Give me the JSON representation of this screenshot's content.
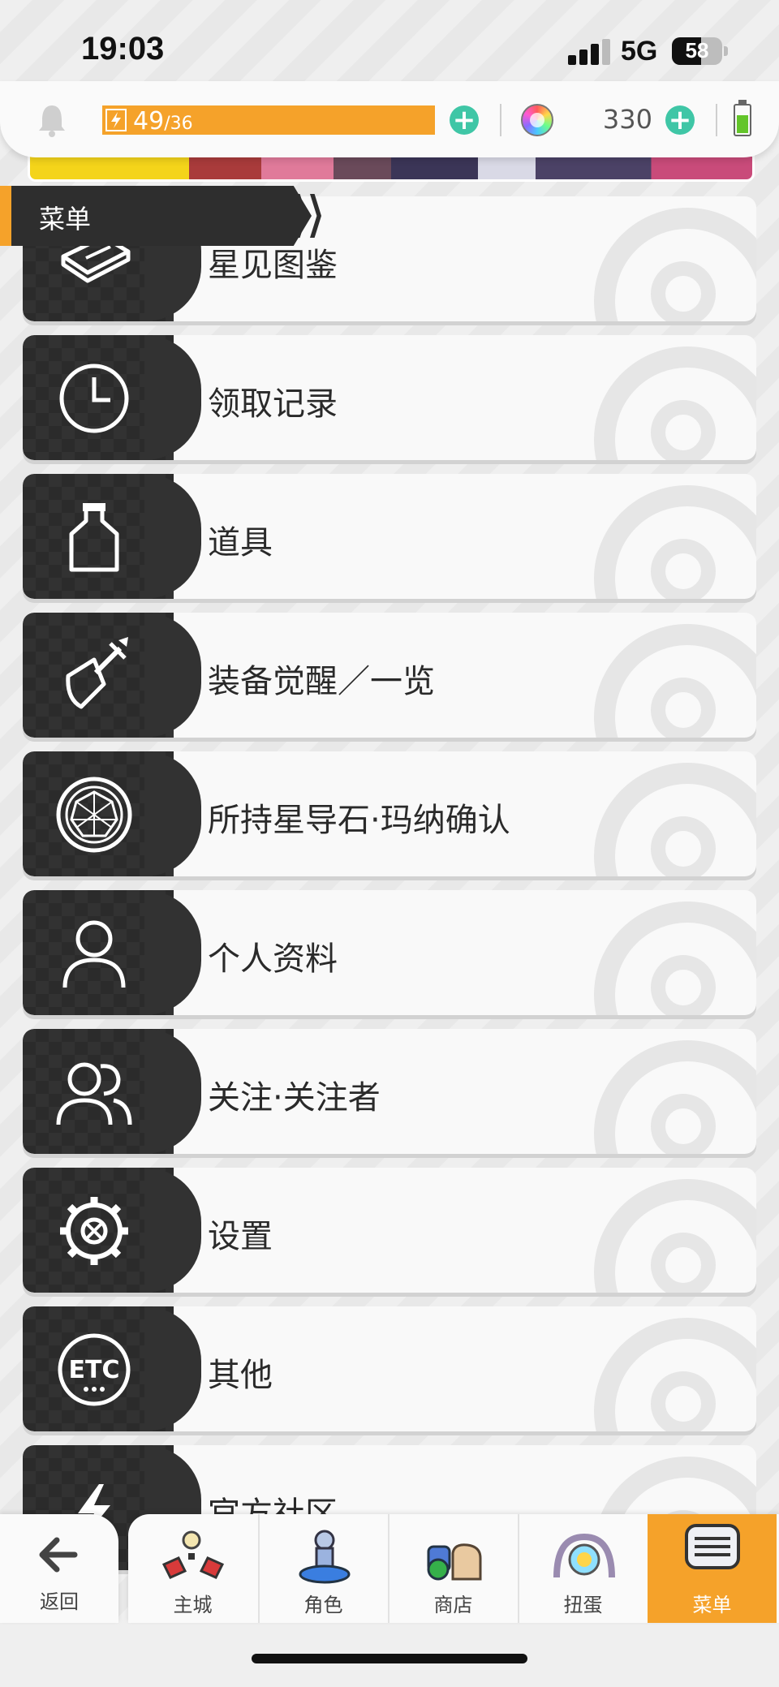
{
  "status_bar": {
    "time": "19:03",
    "network": "5G",
    "battery_percent": "58",
    "battery_level": 0.58
  },
  "resources": {
    "stamina_current": "49",
    "stamina_max": "/36",
    "gem_count": "330",
    "device_battery_level": 0.6
  },
  "menu_tab": {
    "label": "菜单"
  },
  "menu": {
    "items": [
      {
        "label": "星见图鉴",
        "icon": "book-icon"
      },
      {
        "label": "领取记录",
        "icon": "clock-icon"
      },
      {
        "label": "道具",
        "icon": "bottle-icon"
      },
      {
        "label": "装备觉醒／一览",
        "icon": "sword-shield-icon"
      },
      {
        "label": "所持星导石·玛纳确认",
        "icon": "gemstone-icon"
      },
      {
        "label": "个人资料",
        "icon": "person-icon"
      },
      {
        "label": "关注·关注者",
        "icon": "people-icon"
      },
      {
        "label": "设置",
        "icon": "gear-icon"
      },
      {
        "label": "其他",
        "icon": "etc-icon"
      },
      {
        "label": "官方社区",
        "icon": "lightning-icon"
      }
    ]
  },
  "bottom_nav": {
    "back_label": "返回",
    "tabs": [
      {
        "label": "主城",
        "icon": "castle-icon"
      },
      {
        "label": "角色",
        "icon": "character-icon"
      },
      {
        "label": "商店",
        "icon": "shop-bag-icon"
      },
      {
        "label": "扭蛋",
        "icon": "gacha-icon"
      },
      {
        "label": "菜单",
        "icon": "menu-icon",
        "active": true
      }
    ]
  },
  "colors": {
    "accent": "#f5a22a",
    "plus": "#3fc6a6",
    "icon_panel": "#323232"
  }
}
